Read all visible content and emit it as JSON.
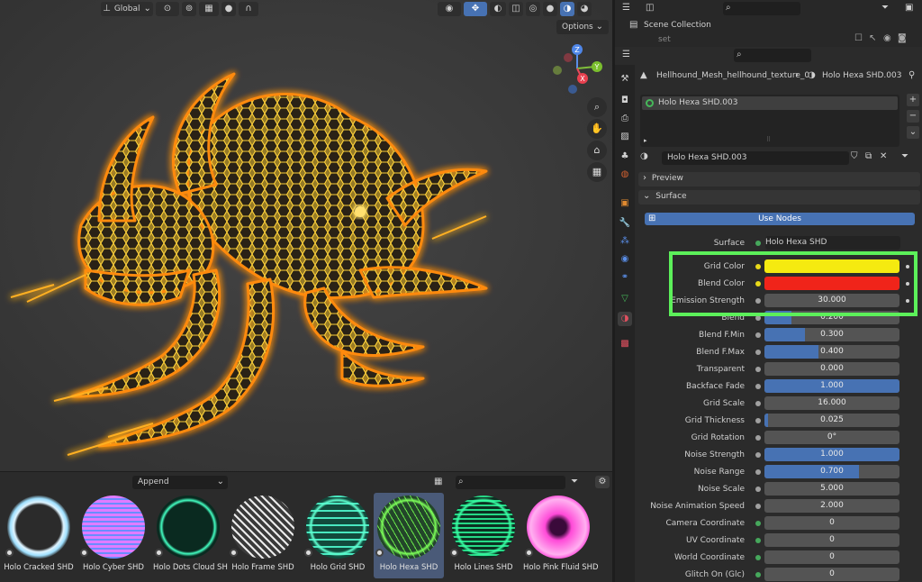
{
  "viewport": {
    "orientation": "Global",
    "options_label": "Options",
    "gizmo": {
      "z": "Z",
      "x": "X",
      "y": "Y"
    }
  },
  "asset_browser": {
    "mode": "Append",
    "items": [
      {
        "label": "Holo Cracked SHD",
        "selected": false
      },
      {
        "label": "Holo Cyber SHD",
        "selected": false
      },
      {
        "label": "Holo Dots Cloud SH",
        "selected": false
      },
      {
        "label": "Holo Frame SHD",
        "selected": false
      },
      {
        "label": "Holo Grid SHD",
        "selected": false
      },
      {
        "label": "Holo Hexa SHD",
        "selected": true
      },
      {
        "label": "Holo Lines SHD",
        "selected": false
      },
      {
        "label": "Holo Pink Fluid SHD",
        "selected": false
      }
    ]
  },
  "outliner": {
    "scene_collection": "Scene Collection",
    "item": "set"
  },
  "properties": {
    "breadcrumb_object": "Hellhound_Mesh_hellhound_texture_0",
    "breadcrumb_material": "Holo Hexa SHD.003",
    "slot_name": "Holo Hexa SHD.003",
    "material_name": "Holo Hexa SHD.003",
    "preview_label": "Preview",
    "surface_label": "Surface",
    "use_nodes_label": "Use Nodes",
    "surface_row": {
      "label": "Surface",
      "value": "Holo Hexa SHD"
    },
    "color_rows": [
      {
        "label": "Grid Color",
        "color": "#f5ea10"
      },
      {
        "label": "Blend Color",
        "color": "#f0241a"
      }
    ],
    "params": [
      {
        "label": "Emission Strength",
        "value": "30.000",
        "fill": 0,
        "dot": "gray"
      },
      {
        "label": "Blend",
        "value": "0.200",
        "fill": 0.2,
        "dot": "gray"
      },
      {
        "label": "Blend F.Min",
        "value": "0.300",
        "fill": 0.3,
        "dot": "gray"
      },
      {
        "label": "Blend F.Max",
        "value": "0.400",
        "fill": 0.4,
        "dot": "gray"
      },
      {
        "label": "Transparent",
        "value": "0.000",
        "fill": 0,
        "dot": "gray"
      },
      {
        "label": "Backface Fade",
        "value": "1.000",
        "fill": 1,
        "dot": "gray"
      },
      {
        "label": "Grid Scale",
        "value": "16.000",
        "fill": 0,
        "dot": "gray"
      },
      {
        "label": "Grid Thickness",
        "value": "0.025",
        "fill": 0.025,
        "dot": "gray"
      },
      {
        "label": "Grid Rotation",
        "value": "0°",
        "fill": 0,
        "dot": "gray"
      },
      {
        "label": "Noise Strength",
        "value": "1.000",
        "fill": 1,
        "dot": "gray"
      },
      {
        "label": "Noise Range",
        "value": "0.700",
        "fill": 0.7,
        "dot": "gray"
      },
      {
        "label": "Noise Scale",
        "value": "5.000",
        "fill": 0,
        "dot": "gray"
      },
      {
        "label": "Noise Animation Speed",
        "value": "2.000",
        "fill": 0,
        "dot": "gray"
      },
      {
        "label": "Camera Coordinate",
        "value": "0",
        "fill": 0,
        "dot": "green"
      },
      {
        "label": "UV Coordinate",
        "value": "0",
        "fill": 0,
        "dot": "green"
      },
      {
        "label": "World Coordinate",
        "value": "0",
        "fill": 0,
        "dot": "green"
      },
      {
        "label": "Glitch On (Glc)",
        "value": "0",
        "fill": 0,
        "dot": "green"
      }
    ]
  },
  "colors": {
    "accent": "#4772b3",
    "highlight": "#5cf05a",
    "glow": "#ff9a18"
  }
}
